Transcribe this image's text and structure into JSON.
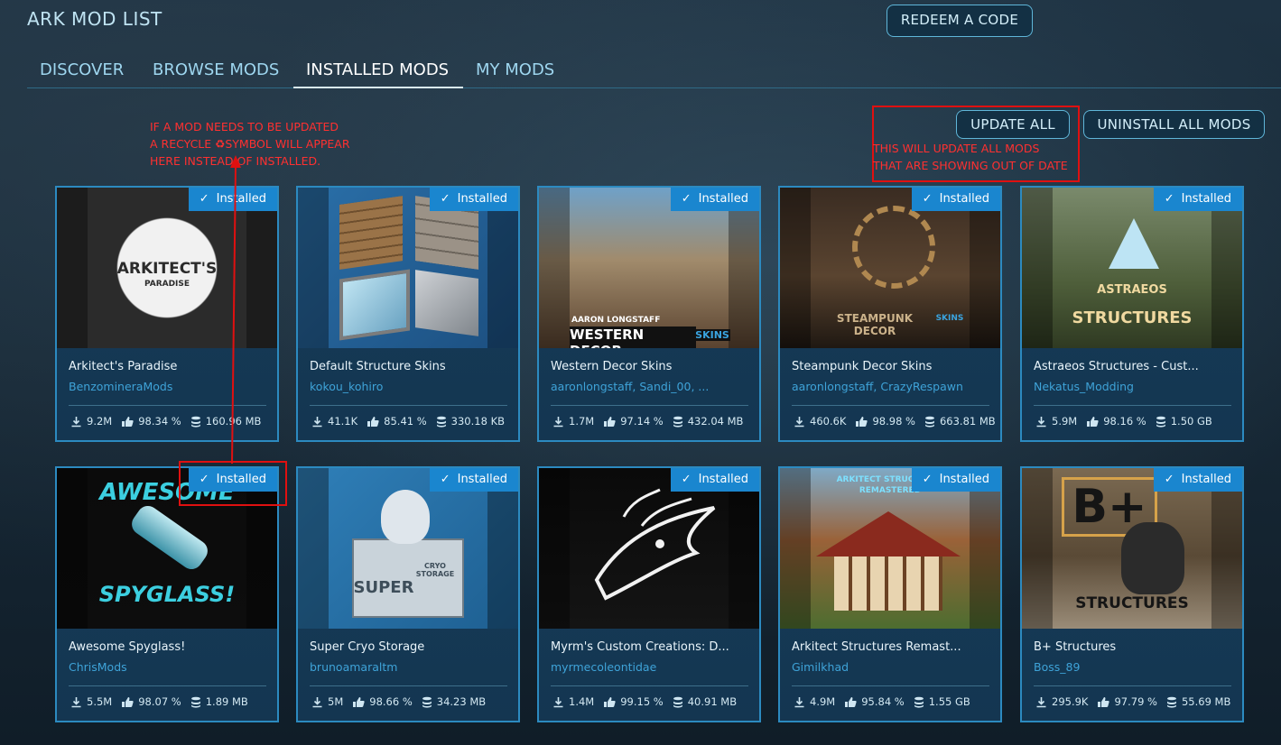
{
  "header": {
    "title": "ARK MOD LIST",
    "redeem_label": "REDEEM A CODE"
  },
  "tabs": [
    {
      "label": "DISCOVER",
      "active": false
    },
    {
      "label": "BROWSE MODS",
      "active": false
    },
    {
      "label": "INSTALLED MODS",
      "active": true
    },
    {
      "label": "MY MODS",
      "active": false
    }
  ],
  "actions": {
    "update_all": "UPDATE ALL",
    "uninstall_all": "UNINSTALL ALL MODS"
  },
  "annotations": {
    "recycle_note": [
      "IF A MOD NEEDS TO BE UPDATED",
      "A RECYCLE ♻SYMBOL WILL APPEAR",
      "HERE INSTEAD OF INSTALLED."
    ],
    "update_note": [
      "THIS WILL UPDATE ALL MODS",
      "THAT ARE SHOWING OUT OF DATE"
    ]
  },
  "installed_label": "Installed",
  "colors": {
    "accent": "#1a86cf",
    "card_border": "#2c8ac0",
    "author": "#3ea3d8",
    "annotation": "#e01010"
  },
  "mods": [
    {
      "name": "Arkitect's Paradise",
      "author": "BenzomineraMods",
      "downloads": "9.2M",
      "rating": "98.34 %",
      "size": "160.96 MB",
      "art_text": "ARKITECT'S",
      "art_sub": "PARADISE"
    },
    {
      "name": "Default Structure Skins",
      "author": "kokou_kohiro",
      "downloads": "41.1K",
      "rating": "85.41 %",
      "size": "330.18 KB",
      "art_text": "",
      "art_sub": ""
    },
    {
      "name": "Western Decor Skins",
      "author": "aaronlongstaff, Sandi_00, ...",
      "downloads": "1.7M",
      "rating": "97.14 %",
      "size": "432.04 MB",
      "art_text": "WESTERN DECOR",
      "art_sub": "AARON LONGSTAFF",
      "art_tag": "SKINS"
    },
    {
      "name": "Steampunk Decor Skins",
      "author": "aaronlongstaff, CrazyRespawn",
      "downloads": "460.6K",
      "rating": "98.98 %",
      "size": "663.81 MB",
      "art_text": "STEAMPUNK DECOR",
      "art_sub": "",
      "art_tag": "SKINS"
    },
    {
      "name": "Astraeos Structures - Cust...",
      "author": "Nekatus_Modding",
      "downloads": "5.9M",
      "rating": "98.16 %",
      "size": "1.50 GB",
      "art_text": "STRUCTURES",
      "art_sub": "ASTRAEOS"
    },
    {
      "name": "Awesome Spyglass!",
      "author": "ChrisMods",
      "downloads": "5.5M",
      "rating": "98.07 %",
      "size": "1.89 MB",
      "art_text": "AWESOME",
      "art_sub": "SPYGLASS!"
    },
    {
      "name": "Super Cryo Storage",
      "author": "brunoamaraltm",
      "downloads": "5M",
      "rating": "98.66 %",
      "size": "34.23 MB",
      "art_text": "SUPER",
      "art_sub": "CRYO STORAGE"
    },
    {
      "name": "Myrm's Custom Creations: D...",
      "author": "myrmecoleontidae",
      "downloads": "1.4M",
      "rating": "99.15 %",
      "size": "40.91 MB",
      "art_text": "",
      "art_sub": ""
    },
    {
      "name": "Arkitect Structures Remast...",
      "author": "Gimilkhad",
      "downloads": "4.9M",
      "rating": "95.84 %",
      "size": "1.55 GB",
      "art_text": "ARKITECT STRUCTURES",
      "art_sub": "REMASTERED"
    },
    {
      "name": "B+ Structures",
      "author": "Boss_89",
      "downloads": "295.9K",
      "rating": "97.79 %",
      "size": "55.69 MB",
      "art_text": "B+",
      "art_sub": "STRUCTURES"
    }
  ]
}
